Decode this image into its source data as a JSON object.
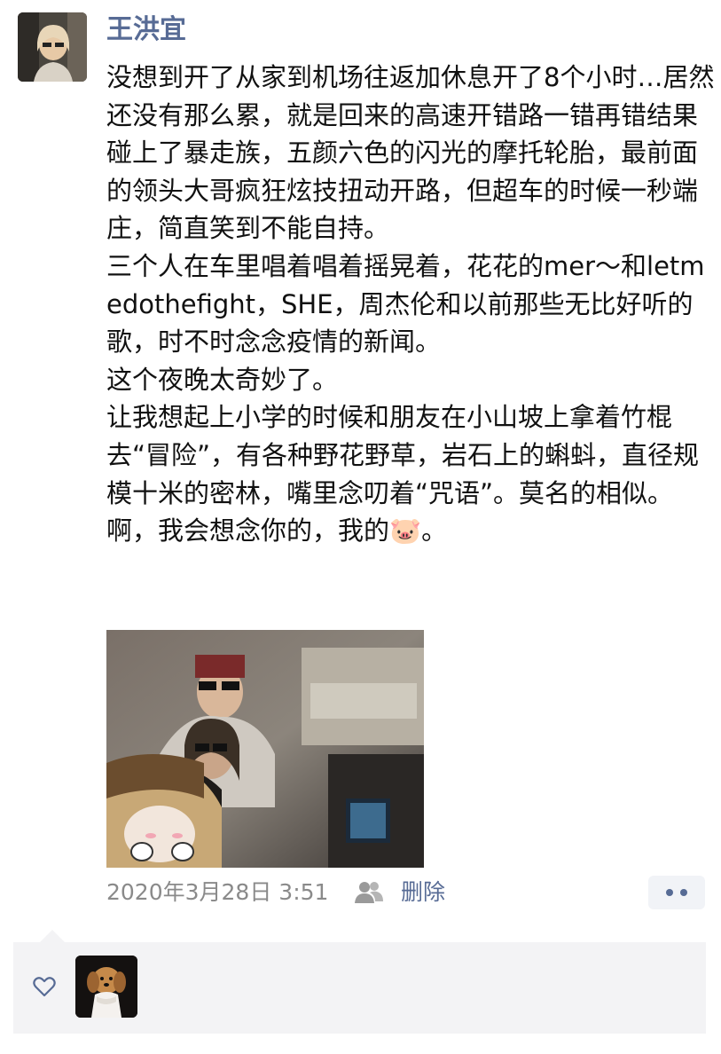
{
  "author": {
    "name": "王洪宜"
  },
  "post": {
    "text": "没想到开了从家到机场往返加休息开了8个小时…居然还没有那么累，就是回来的高速开错路一错再错结果碰上了暴走族，五颜六色的闪光的摩托轮胎，最前面的领头大哥疯狂炫技扭动开路，但超车的时候一秒端庄，简直笑到不能自持。\n三个人在车里唱着唱着摇晃着，花花的mer～和letmedothefight，SHE，周杰伦和以前那些无比好听的歌，时不时念念疫情的新闻。\n这个夜晚太奇妙了。\n让我想起上小学的时候和朋友在小山坡上拿着竹棍去“冒险”，有各种野花野草，岩石上的蝌蚪，直径规模十米的密林，嘴里念叨着“咒语”。莫名的相似。\n啊，我会想念你的，我的🐷。"
  },
  "meta": {
    "timestamp": "2020年3月28日 3:51",
    "delete_label": "删除"
  },
  "icons": {
    "visibility": "people-icon",
    "more": "more-dots-icon",
    "like": "heart-outline-icon"
  },
  "colors": {
    "link": "#576b95",
    "meta_text": "#8a8a8a",
    "likes_bg": "#f3f3f5"
  }
}
